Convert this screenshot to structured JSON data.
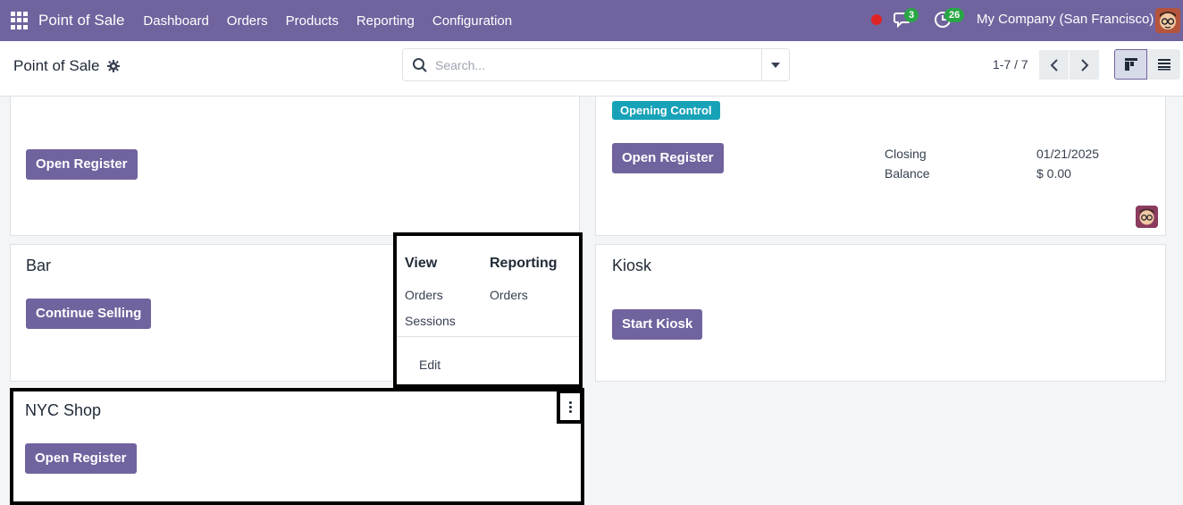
{
  "navbar": {
    "app_name": "Point of Sale",
    "menu": [
      "Dashboard",
      "Orders",
      "Products",
      "Reporting",
      "Configuration"
    ],
    "messages_count": "3",
    "activities_count": "26",
    "company": "My Company (San Francisco)"
  },
  "control_panel": {
    "title": "Point of Sale",
    "search_placeholder": "Search...",
    "pager": "1-7 / 7"
  },
  "cards": {
    "top_left": {
      "button": "Open Register"
    },
    "top_right": {
      "tag": "Opening Control",
      "button": "Open Register",
      "closing_label": "Closing",
      "closing_value": "01/21/2025",
      "balance_label": "Balance",
      "balance_value": "$ 0.00"
    },
    "bar": {
      "title": "Bar",
      "button": "Continue Selling"
    },
    "kiosk": {
      "title": "Kiosk",
      "button": "Start Kiosk"
    },
    "nyc": {
      "title": "NYC Shop",
      "button": "Open Register"
    }
  },
  "dropdown": {
    "view_header": "View",
    "reporting_header": "Reporting",
    "view_items": [
      "Orders",
      "Sessions"
    ],
    "reporting_items": [
      "Orders"
    ],
    "edit": "Edit"
  },
  "colors": {
    "brand": "#71639e",
    "tag": "#17a2b8",
    "badge": "#28a745",
    "record": "#e02424"
  }
}
